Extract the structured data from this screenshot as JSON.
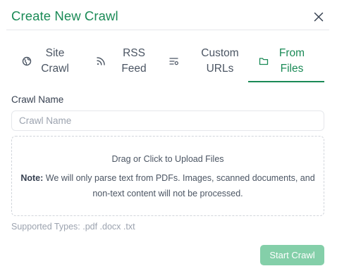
{
  "dialog": {
    "title": "Create New Crawl",
    "accent_color": "#1a8a56"
  },
  "tabs": [
    {
      "line1": "Site",
      "line2": "Crawl",
      "icon": "globe-icon",
      "active": false
    },
    {
      "line1": "RSS",
      "line2": "Feed",
      "icon": "rss-icon",
      "active": false
    },
    {
      "line1": "Custom",
      "line2": "URLs",
      "icon": "list-filter-icon",
      "active": false
    },
    {
      "line1": "From",
      "line2": "Files",
      "icon": "folder-icon",
      "active": true
    }
  ],
  "form": {
    "crawl_name_label": "Crawl Name",
    "crawl_name_placeholder": "Crawl Name",
    "crawl_name_value": ""
  },
  "upload": {
    "title": "Drag or Click to Upload Files",
    "note_label": "Note:",
    "note_text": " We will only parse text from PDFs. Images, scanned documents, and non-text content will not be processed.",
    "supported_types": "Supported Types: .pdf .docx .txt"
  },
  "actions": {
    "start_label": "Start Crawl",
    "start_color": "#84cfa9"
  }
}
